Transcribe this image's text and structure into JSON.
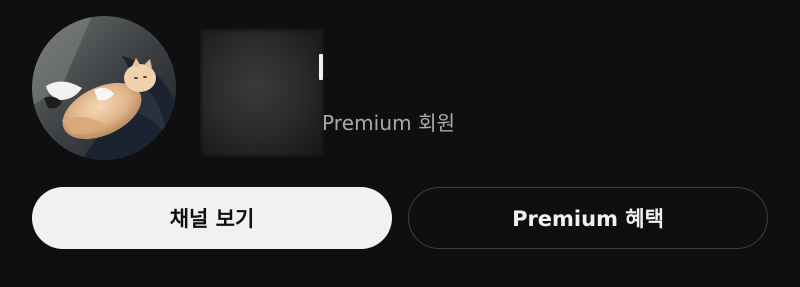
{
  "profile": {
    "avatar_icon": "profile-photo-kitten-icon",
    "name_redacted": true,
    "membership_label": "Premium 회원"
  },
  "actions": {
    "view_channel_label": "채널 보기",
    "premium_benefits_label": "Premium 혜택"
  },
  "colors": {
    "background": "#0f0f0f",
    "primary_button_bg": "#f1f1f1",
    "primary_button_text": "#0f0f0f",
    "secondary_button_border": "#3e3e3e",
    "secondary_text": "#aaaaaa"
  }
}
